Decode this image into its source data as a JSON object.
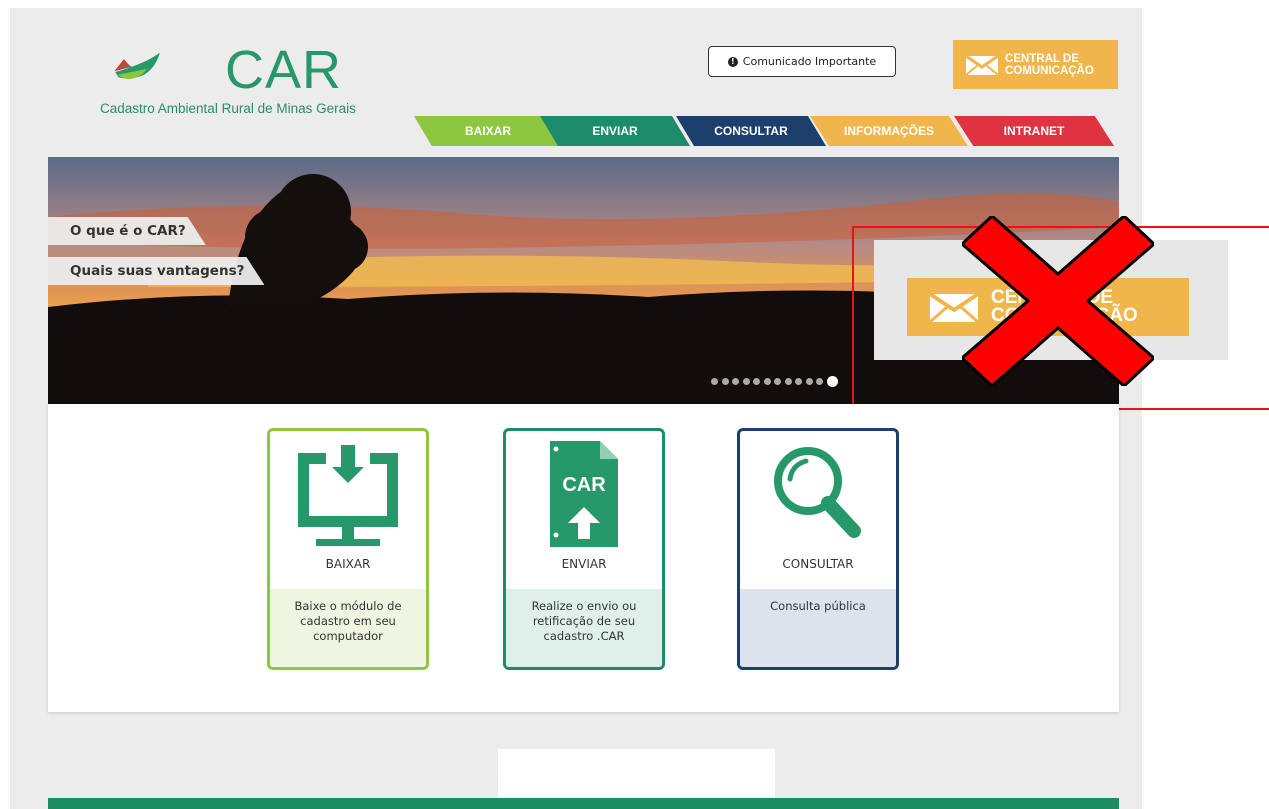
{
  "header": {
    "logo_title": "CAR",
    "logo_subtitle": "Cadastro Ambiental Rural de Minas Gerais",
    "comunicado_label": "Comunicado Importante",
    "central_label_line1": "CENTRAL DE",
    "central_label_line2": "COMUNICAÇÃO"
  },
  "nav": {
    "tabs": [
      {
        "label": "BAIXAR",
        "color": "#8dc63f"
      },
      {
        "label": "ENVIAR",
        "color": "#1c8c6a"
      },
      {
        "label": "CONSULTAR",
        "color": "#1d3f6e"
      },
      {
        "label": "INFORMAÇÕES",
        "color": "#f1b64b"
      },
      {
        "label": "INTRANET",
        "color": "#e03341"
      }
    ]
  },
  "banner": {
    "side_tabs": [
      "O que é o CAR?",
      "Quais suas vantagens?"
    ],
    "carousel_dots": 12,
    "active_dot_index": 11
  },
  "popup": {
    "label_line1": "CENTRAL DE",
    "label_line2": "COMUNICAÇÃO"
  },
  "cards": [
    {
      "title": "BAIXAR",
      "description": "Baixe o módulo de cadastro em seu computador",
      "border_color": "#8dc63f",
      "desc_bg": "#eef6e1",
      "icon": "monitor-download-icon"
    },
    {
      "title": "ENVIAR",
      "description": "Realize o envio ou retificação de seu cadastro .CAR",
      "icon_text": "CAR",
      "border_color": "#1c8c6a",
      "desc_bg": "#dff0ea",
      "icon": "file-upload-icon"
    },
    {
      "title": "CONSULTAR",
      "description": "Consulta pública",
      "border_color": "#1d3f6e",
      "desc_bg": "#dde3ec",
      "icon": "search-icon"
    }
  ],
  "colors": {
    "brand_green": "#27986a",
    "accent_orange": "#f1b64b",
    "annotation_red": "#e11111"
  }
}
